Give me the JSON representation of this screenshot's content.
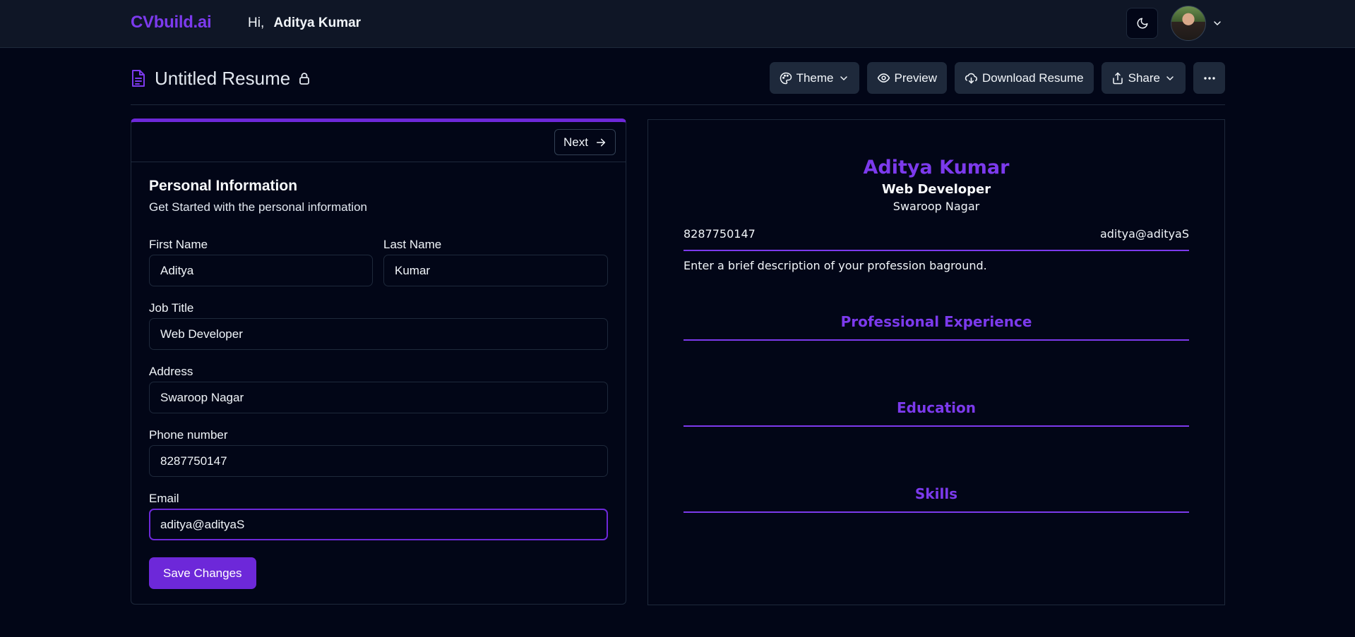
{
  "navbar": {
    "logo": "CVbuild.ai",
    "greeting_prefix": "Hi,",
    "user_name": "Aditya Kumar"
  },
  "toolbar": {
    "document_title": "Untitled Resume",
    "theme_label": "Theme",
    "preview_label": "Preview",
    "download_label": "Download Resume",
    "share_label": "Share"
  },
  "form": {
    "next_label": "Next",
    "section_title": "Personal Information",
    "section_subtitle": "Get Started with the personal information",
    "fields": {
      "first_name": {
        "label": "First Name",
        "value": "Aditya"
      },
      "last_name": {
        "label": "Last Name",
        "value": "Kumar"
      },
      "job_title": {
        "label": "Job Title",
        "value": "Web Developer"
      },
      "address": {
        "label": "Address",
        "value": "Swaroop Nagar"
      },
      "phone": {
        "label": "Phone number",
        "value": "8287750147"
      },
      "email": {
        "label": "Email",
        "value": "aditya@adityaS"
      }
    },
    "save_label": "Save Changes"
  },
  "preview": {
    "name": "Aditya Kumar",
    "job_title": "Web Developer",
    "address": "Swaroop Nagar",
    "phone": "8287750147",
    "email": "aditya@adityaS",
    "summary": "Enter a brief description of your profession baground.",
    "sections": [
      "Professional Experience",
      "Education",
      "Skills"
    ]
  },
  "colors": {
    "accent": "#7c3aed",
    "button_primary": "#6d28d9",
    "background": "#020617",
    "navbar": "#0f1626"
  },
  "icons": [
    "moon-icon",
    "chevron-down-icon",
    "document-icon",
    "lock-icon",
    "palette-icon",
    "eye-icon",
    "cloud-download-icon",
    "share-icon",
    "ellipsis-icon",
    "arrow-right-icon"
  ]
}
